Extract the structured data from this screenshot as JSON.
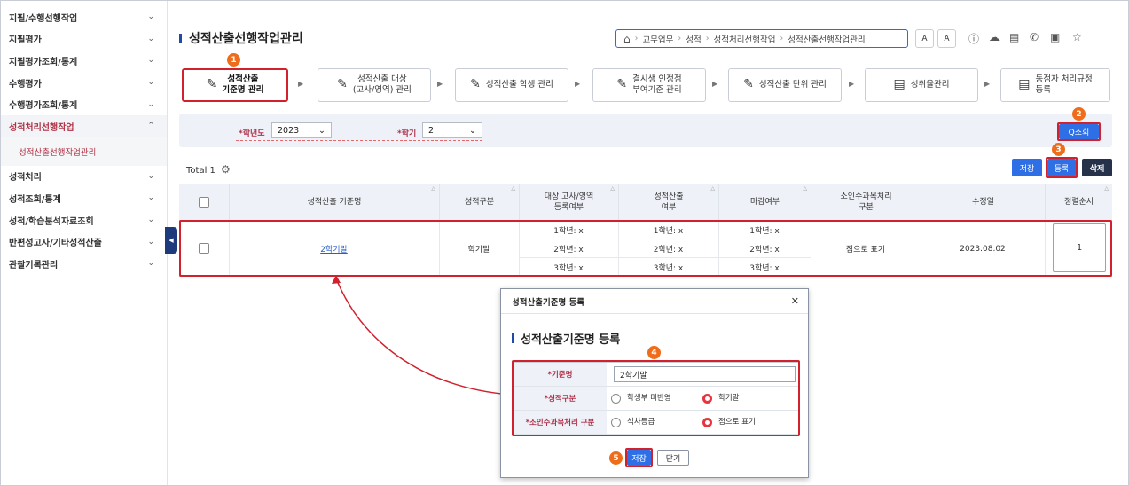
{
  "sidebar": {
    "items": [
      {
        "label": "지필/수행선행작업",
        "chev": "⌄"
      },
      {
        "label": "지필평가",
        "chev": "⌄"
      },
      {
        "label": "지필평가조회/통계",
        "chev": "⌄"
      },
      {
        "label": "수행평가",
        "chev": "⌄"
      },
      {
        "label": "수행평가조회/통계",
        "chev": "⌄"
      },
      {
        "label": "성적처리선행작업",
        "chev": "⌃"
      },
      {
        "label": "성적산출선행작업관리"
      },
      {
        "label": "성적처리",
        "chev": "⌄"
      },
      {
        "label": "성적조회/통계",
        "chev": "⌄"
      },
      {
        "label": "성적/학습분석자료조회",
        "chev": "⌄"
      },
      {
        "label": "반편성고사/기타성적산출",
        "chev": "⌄"
      },
      {
        "label": "관찰기록관리",
        "chev": "⌄"
      }
    ]
  },
  "header": {
    "title": "성적산출선행작업관리",
    "breadcrumb": [
      "교무업무",
      "성적",
      "성적처리선행작업",
      "성적산출선행작업관리"
    ],
    "font_buttons": [
      "A",
      "A"
    ],
    "toolbar_icons": [
      "help-icon",
      "chat-icon",
      "document-icon",
      "phone-icon",
      "screen-icon",
      "star-icon"
    ]
  },
  "steps": [
    {
      "line1": "성적산출",
      "line2": "기준명 관리"
    },
    {
      "line1": "성적산출 대상",
      "line2": "(고사/영역) 관리"
    },
    {
      "line1": "성적산출 학생 관리",
      "line2": ""
    },
    {
      "line1": "결시생 인정점",
      "line2": "부여기준 관리"
    },
    {
      "line1": "성적산출 단위 관리",
      "line2": ""
    },
    {
      "line1": "성취율관리",
      "line2": ""
    },
    {
      "line1": "동점자 처리규정",
      "line2": "등록"
    }
  ],
  "search": {
    "year_label": "*학년도",
    "year_value": "2023",
    "term_label": "*학기",
    "term_value": "2",
    "search_button": "Q조회"
  },
  "list": {
    "total": "Total 1",
    "buttons": {
      "save": "저장",
      "register": "등록",
      "delete": "삭제"
    },
    "columns": [
      {
        "label": "성적산출 기준명"
      },
      {
        "label": "성적구분"
      },
      {
        "label": "대상 고사/영역\n등록여부"
      },
      {
        "label": "성적산출\n여부"
      },
      {
        "label": "마감여부"
      },
      {
        "label": "소인수과목처리\n구분"
      },
      {
        "label": "수정일"
      },
      {
        "label": "정렬순서"
      }
    ],
    "rows": [
      {
        "name": "2학기말",
        "grade_type": "학기말",
        "target_registered": [
          "1학년: x",
          "2학년: x",
          "3학년: x"
        ],
        "calculated": [
          "1학년: x",
          "2학년: x",
          "3학년: x"
        ],
        "closed": [
          "1학년: x",
          "2학년: x",
          "3학년: x"
        ],
        "small_subject": "점으로 표기",
        "modified": "2023.08.02",
        "order": "1"
      }
    ]
  },
  "modal": {
    "header": "성적산출기준명 등록",
    "title": "성적산출기준명 등록",
    "fields": {
      "name_label": "*기준명",
      "name_value": "2학기말",
      "type_label": "*성적구분",
      "type_opt1": "학생부 미반영",
      "type_opt2": "학기말",
      "small_label": "*소인수과목처리 구분",
      "small_opt1": "석차등급",
      "small_opt2": "점으로 표기"
    },
    "save": "저장",
    "close": "닫기"
  },
  "annotations": [
    "1",
    "2",
    "3",
    "4",
    "5"
  ],
  "colors": {
    "accent": "#2e6fe6",
    "highlight": "#d0212d",
    "badge": "#ef6c1a",
    "label_red": "#b0314a",
    "dark_button": "#26324a"
  }
}
